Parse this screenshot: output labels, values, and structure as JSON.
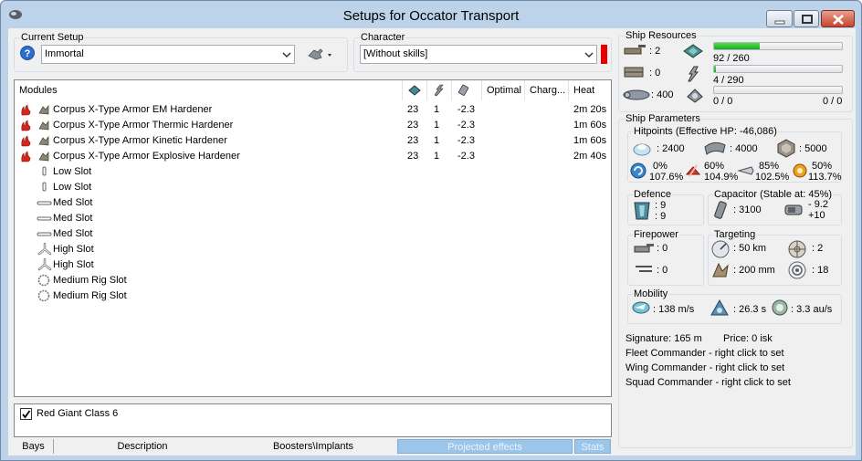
{
  "window": {
    "title": "Setups for Occator Transport"
  },
  "current_setup": {
    "label": "Current Setup",
    "value": "Immortal"
  },
  "character": {
    "label": "Character",
    "value": "[Without skills]"
  },
  "modules": {
    "columns": {
      "name": "Modules",
      "optimal": "Optimal",
      "charge": "Charg...",
      "heat": "Heat"
    },
    "rows": [
      {
        "name": "Corpus X-Type Armor EM Hardener",
        "cpu": "23",
        "pg": "1",
        "cap": "-2.3",
        "heat": "2m 20s"
      },
      {
        "name": "Corpus X-Type Armor Thermic Hardener",
        "cpu": "23",
        "pg": "1",
        "cap": "-2.3",
        "heat": "1m 60s"
      },
      {
        "name": "Corpus X-Type Armor Kinetic Hardener",
        "cpu": "23",
        "pg": "1",
        "cap": "-2.3",
        "heat": "1m 60s"
      },
      {
        "name": "Corpus X-Type Armor Explosive Hardener",
        "cpu": "23",
        "pg": "1",
        "cap": "-2.3",
        "heat": "2m 40s"
      }
    ],
    "slots": [
      {
        "name": "Low Slot",
        "icon": "low-slot-icon"
      },
      {
        "name": "Low Slot",
        "icon": "low-slot-icon"
      },
      {
        "name": "Med Slot",
        "icon": "med-slot-icon"
      },
      {
        "name": "Med Slot",
        "icon": "med-slot-icon"
      },
      {
        "name": "Med Slot",
        "icon": "med-slot-icon"
      },
      {
        "name": "High Slot",
        "icon": "high-slot-icon"
      },
      {
        "name": "High Slot",
        "icon": "high-slot-icon"
      },
      {
        "name": "Medium Rig Slot",
        "icon": "rig-slot-icon"
      },
      {
        "name": "Medium Rig Slot",
        "icon": "rig-slot-icon"
      }
    ]
  },
  "projected": {
    "item": "Red Giant Class 6",
    "checked": true
  },
  "bottom_tabs": {
    "bays": "Bays",
    "description": "Description",
    "boosters": "Boosters\\Implants",
    "projected": "Projected effects",
    "stats": "Stats"
  },
  "ship_resources": {
    "label": "Ship Resources",
    "turret_hardpoints": ": 2",
    "launcher_hardpoints": ": 0",
    "drone_bandwidth": ": 400",
    "cpu_text": "92 / 260",
    "cpu_fraction": 0.354,
    "powergrid_text": "4 / 290",
    "powergrid_fraction": 0.014,
    "calibration_used": "0 / 0",
    "calibration_total": "0 / 0",
    "calibration_fraction": 0
  },
  "ship_parameters": {
    "label": "Ship Parameters",
    "hitpoints": {
      "label": "Hitpoints (Effective HP: -46,086)",
      "shield": ": 2400",
      "armor": ": 4000",
      "structure": ": 5000",
      "res": [
        {
          "top": "0%",
          "bottom": "107.6%"
        },
        {
          "top": "60%",
          "bottom": "104.9%"
        },
        {
          "top": "85%",
          "bottom": "102.5%"
        },
        {
          "top": "50%",
          "bottom": "113.7%"
        }
      ]
    },
    "defence": {
      "label": "Defence",
      "top": ": 9",
      "bottom": ": 9"
    },
    "capacitor": {
      "label": "Capacitor (Stable at: 45%)",
      "capacity": ": 3100",
      "delta_top": "- 9.2",
      "delta_bottom": "+10"
    },
    "firepower": {
      "label": "Firepower",
      "turret": ": 0",
      "missile": ": 0"
    },
    "targeting": {
      "label": "Targeting",
      "range": ": 50 km",
      "targets": ": 2",
      "scan": ": 200 mm",
      "sensor": ": 18"
    },
    "mobility": {
      "label": "Mobility",
      "speed": ": 138 m/s",
      "align": ": 26.3 s",
      "warp": ": 3.3 au/s"
    }
  },
  "footer": {
    "signature": "Signature: 165 m",
    "price": "Price: 0 isk",
    "fleet": "Fleet Commander - right click to set",
    "wing": "Wing Commander - right click to set",
    "squad": "Squad Commander - right click to set"
  }
}
